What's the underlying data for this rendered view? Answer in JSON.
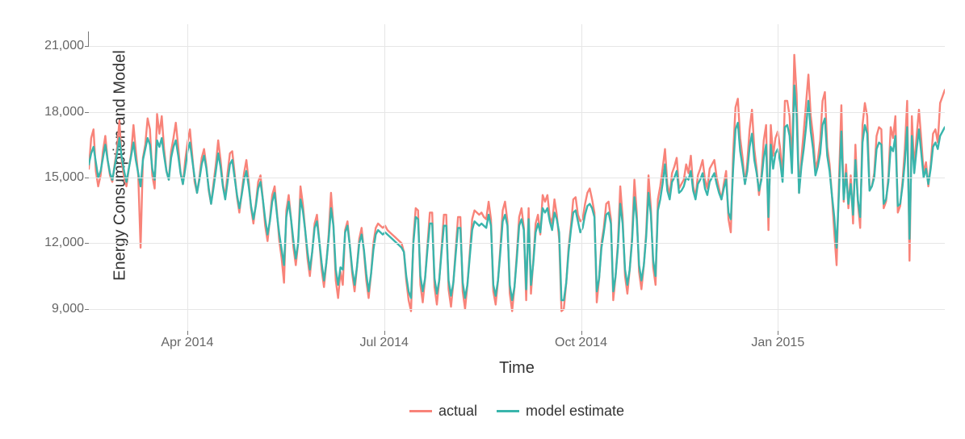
{
  "chart_data": {
    "type": "line",
    "xlabel": "Time",
    "ylabel": "Energy Consumption and Model",
    "ylim": [
      8000,
      22000
    ],
    "y_ticks": [
      9000,
      12000,
      15000,
      18000,
      21000
    ],
    "y_tick_labels": [
      "9,000",
      "12,000",
      "15,000",
      "18,000",
      "21,000"
    ],
    "x_tick_labels": [
      "Apr 2014",
      "Jul 2014",
      "Oct 2014",
      "Jan 2015"
    ],
    "x_tick_fracs": [
      0.115,
      0.345,
      0.575,
      0.805
    ],
    "colors": {
      "actual": "#f88379",
      "model estimate": "#39b5ac"
    },
    "legend": [
      "actual",
      "model estimate"
    ],
    "n_points": 365,
    "series": [
      {
        "name": "actual",
        "values": [
          15400,
          16800,
          17200,
          15300,
          14600,
          15100,
          16200,
          16900,
          15800,
          15100,
          14800,
          15600,
          16300,
          17600,
          15700,
          15000,
          14600,
          15400,
          16100,
          17400,
          16200,
          15100,
          11800,
          15900,
          16500,
          17700,
          17200,
          15100,
          14500,
          17900,
          17000,
          17800,
          16300,
          15300,
          14900,
          16200,
          16800,
          17500,
          16400,
          15200,
          14700,
          15800,
          16600,
          17200,
          16000,
          14800,
          14300,
          15000,
          15900,
          16300,
          15500,
          14400,
          13800,
          14700,
          15600,
          16700,
          15800,
          14700,
          14100,
          15200,
          16100,
          16200,
          15200,
          14100,
          13400,
          14300,
          15200,
          15800,
          14800,
          13600,
          12900,
          13800,
          14800,
          15100,
          14000,
          12800,
          12100,
          13100,
          14200,
          14600,
          13400,
          12100,
          11300,
          10200,
          13500,
          14200,
          13100,
          11800,
          11000,
          12000,
          14600,
          13800,
          12600,
          11300,
          10500,
          11600,
          12900,
          13300,
          12100,
          10800,
          10000,
          11100,
          12400,
          14300,
          12800,
          10300,
          9500,
          10700,
          10100,
          12600,
          13000,
          11900,
          10600,
          9800,
          10900,
          12200,
          12700,
          11600,
          10300,
          9500,
          10600,
          12000,
          12700,
          12900,
          12800,
          12700,
          12800,
          12600,
          12500,
          12400,
          12300,
          12200,
          12100,
          12000,
          11600,
          10300,
          9400,
          8900,
          12200,
          13600,
          13500,
          10100,
          9300,
          10400,
          11900,
          13400,
          13400,
          10000,
          9200,
          10300,
          11800,
          13300,
          13300,
          9900,
          9100,
          10200,
          11700,
          13200,
          13200,
          9800,
          9000,
          10100,
          11600,
          13100,
          13500,
          13400,
          13300,
          13400,
          13200,
          13100,
          13900,
          13100,
          9800,
          9200,
          10300,
          11800,
          13500,
          13900,
          13000,
          9700,
          8900,
          10000,
          11500,
          13200,
          13600,
          12700,
          9400,
          13600,
          9700,
          11200,
          12900,
          13300,
          12400,
          14200,
          13900,
          14200,
          13200,
          12900,
          14000,
          13300,
          12200,
          8900,
          9000,
          10200,
          11800,
          12800,
          14000,
          14100,
          13300,
          13000,
          13100,
          13800,
          14300,
          14500,
          14000,
          13400,
          9300,
          10400,
          12000,
          12700,
          13800,
          13900,
          13100,
          9400,
          10500,
          12000,
          14600,
          13200,
          10500,
          9700,
          10800,
          12300,
          14900,
          13400,
          10700,
          9900,
          11000,
          12500,
          15100,
          13600,
          10900,
          10100,
          14000,
          14600,
          15400,
          16300,
          14700,
          14200,
          15200,
          15500,
          15900,
          14500,
          14700,
          14900,
          15600,
          15200,
          16000,
          14600,
          14100,
          15100,
          15400,
          15800,
          14900,
          14500,
          15400,
          15600,
          15800,
          15000,
          14500,
          14000,
          14700,
          15300,
          13100,
          12500,
          16100,
          18200,
          18600,
          16800,
          15900,
          14700,
          15700,
          17200,
          18100,
          16300,
          15400,
          14200,
          15100,
          16700,
          17400,
          12600,
          17400,
          16000,
          16800,
          17100,
          16300,
          15000,
          18500,
          18500,
          17800,
          15500,
          20600,
          18800,
          14300,
          15900,
          17100,
          18400,
          19700,
          17800,
          16900,
          15400,
          15800,
          16700,
          18500,
          18900,
          16400,
          15600,
          14200,
          12500,
          11000,
          14900,
          18300,
          13900,
          15600,
          13600,
          15100,
          12900,
          16500,
          13900,
          12700,
          17400,
          18400,
          17800,
          14500,
          14600,
          15200,
          16900,
          17300,
          17200,
          13600,
          13900,
          15000,
          17300,
          16800,
          17800,
          13400,
          13700,
          14800,
          16300,
          18500,
          11200,
          17800,
          15400,
          16900,
          18100,
          16700,
          15200,
          15700,
          14600,
          15600,
          17000,
          17200,
          16600,
          18400,
          18700,
          19000
        ]
      },
      {
        "name": "model estimate",
        "values": [
          15600,
          16100,
          16400,
          15700,
          15000,
          15300,
          15900,
          16500,
          15800,
          15200,
          14900,
          15500,
          16100,
          16800,
          15900,
          15300,
          14800,
          15400,
          16000,
          16600,
          15800,
          15200,
          14600,
          15800,
          16300,
          16800,
          16500,
          15400,
          14900,
          16700,
          16400,
          16800,
          16000,
          15300,
          14900,
          15900,
          16400,
          16700,
          16000,
          15200,
          14700,
          15400,
          16200,
          16600,
          15800,
          15000,
          14300,
          14900,
          15600,
          16000,
          15400,
          14500,
          13800,
          14500,
          15300,
          16100,
          15500,
          14600,
          14000,
          14800,
          15600,
          15800,
          15000,
          14200,
          13600,
          14200,
          14900,
          15300,
          14600,
          13700,
          13100,
          13700,
          14500,
          14800,
          14000,
          13100,
          12400,
          13000,
          13900,
          14300,
          13300,
          12400,
          11700,
          11000,
          13200,
          13900,
          13100,
          12100,
          11300,
          12000,
          14000,
          13500,
          12600,
          11600,
          10800,
          11600,
          12700,
          13000,
          12100,
          11100,
          10300,
          11100,
          12200,
          13600,
          12800,
          10800,
          10100,
          10900,
          10800,
          12500,
          12800,
          11900,
          10800,
          10100,
          10900,
          12000,
          12400,
          11700,
          10600,
          9800,
          10600,
          11700,
          12400,
          12600,
          12500,
          12400,
          12500,
          12400,
          12300,
          12200,
          12100,
          12000,
          11900,
          11800,
          11600,
          10500,
          9800,
          9500,
          12000,
          13200,
          13100,
          10500,
          9800,
          10400,
          11700,
          12900,
          12900,
          10400,
          9700,
          10300,
          11600,
          12800,
          12800,
          10300,
          9600,
          10200,
          11500,
          12700,
          12700,
          10200,
          9500,
          10100,
          11400,
          12600,
          13000,
          12900,
          12800,
          12900,
          12800,
          12700,
          13300,
          12800,
          10100,
          9600,
          10300,
          11600,
          13000,
          13300,
          12800,
          10100,
          9400,
          10000,
          11300,
          12800,
          13100,
          12600,
          9900,
          13100,
          10100,
          11100,
          12500,
          12900,
          12500,
          13600,
          13400,
          13600,
          13000,
          12600,
          13400,
          13100,
          12500,
          9400,
          9400,
          10200,
          11600,
          12600,
          13400,
          13500,
          13000,
          12500,
          12700,
          13300,
          13700,
          13800,
          13600,
          13200,
          9800,
          10400,
          11800,
          12500,
          13300,
          13400,
          12900,
          9800,
          10500,
          11800,
          13800,
          12900,
          10800,
          10100,
          10800,
          12100,
          14100,
          13100,
          11000,
          10300,
          11000,
          12300,
          14300,
          13300,
          11200,
          10500,
          13500,
          14000,
          14700,
          15600,
          14400,
          14000,
          14800,
          15000,
          15300,
          14300,
          14400,
          14600,
          15000,
          14900,
          15300,
          14400,
          14000,
          14700,
          14900,
          15200,
          14500,
          14200,
          14800,
          15000,
          15200,
          14700,
          14300,
          14000,
          14500,
          14900,
          13400,
          13100,
          15400,
          17200,
          17500,
          16200,
          15500,
          14700,
          15300,
          16400,
          17000,
          15800,
          15200,
          14400,
          14900,
          15900,
          16500,
          13200,
          16500,
          15400,
          16100,
          16300,
          15700,
          14800,
          17300,
          17400,
          16900,
          15200,
          19200,
          17800,
          14300,
          15500,
          16300,
          17300,
          18500,
          17100,
          16300,
          15100,
          15500,
          16100,
          17400,
          17700,
          16000,
          15300,
          14200,
          13200,
          11800,
          14400,
          17100,
          14000,
          15200,
          13800,
          14700,
          13300,
          15800,
          14000,
          13200,
          16600,
          17400,
          17000,
          14400,
          14600,
          15000,
          16300,
          16600,
          16500,
          13800,
          14000,
          14800,
          16400,
          16200,
          16900,
          13700,
          13800,
          14600,
          15700,
          17300,
          12200,
          16900,
          15200,
          16300,
          17200,
          16100,
          15000,
          15400,
          14700,
          15400,
          16400,
          16600,
          16300,
          16900,
          17100,
          17300
        ]
      }
    ]
  }
}
